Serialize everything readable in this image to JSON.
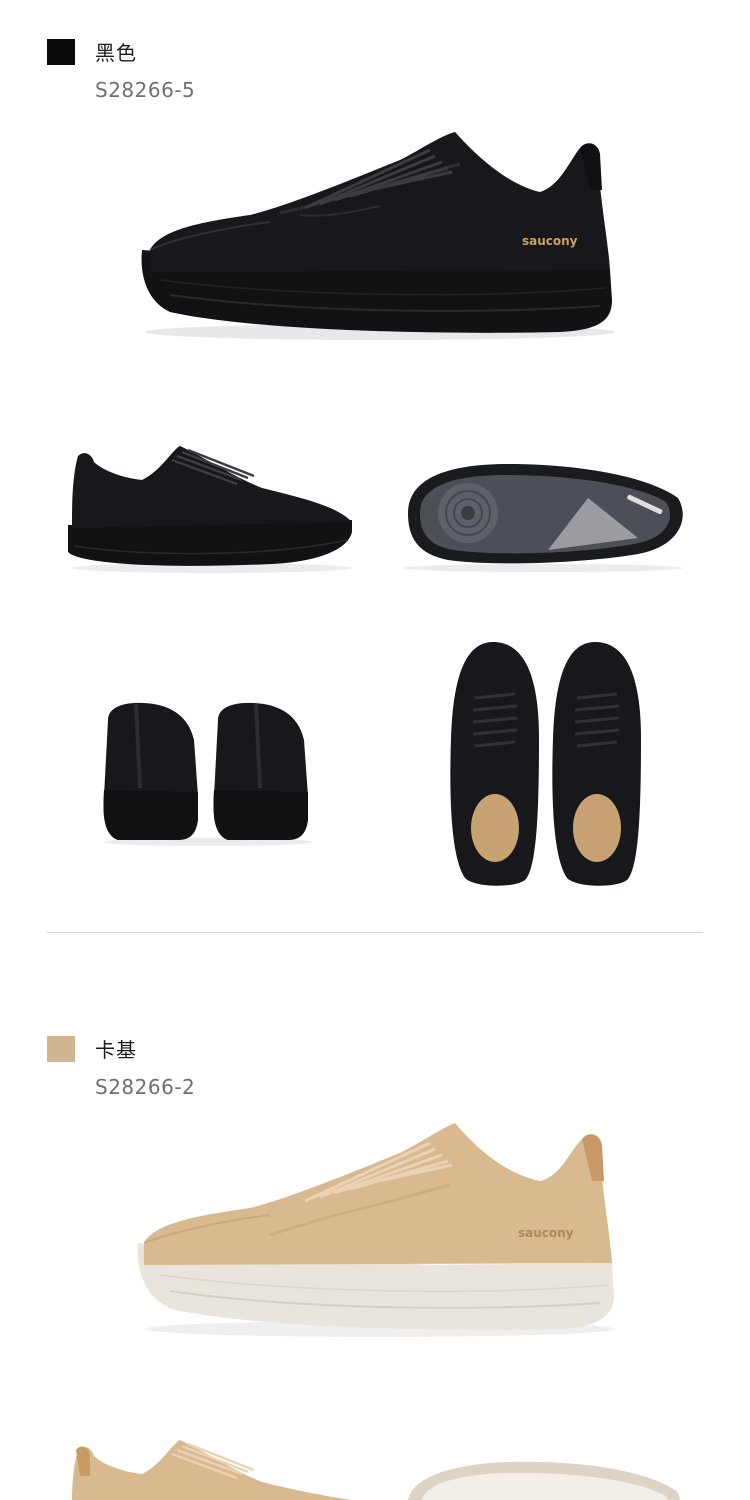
{
  "variants": [
    {
      "color_name": "黑色",
      "sku": "S28266-5",
      "swatch_color": "#0a0a0a",
      "images": [
        "side-view-right",
        "side-view-left",
        "outsole-view",
        "back-view",
        "top-view"
      ],
      "brand_mark": "saucony"
    },
    {
      "color_name": "卡基",
      "sku": "S28266-2",
      "swatch_color": "#d2b68f",
      "images": [
        "side-view-right",
        "side-view-left",
        "outsole-view"
      ],
      "brand_mark": "saucony"
    }
  ],
  "colors": {
    "black_upper": "#17181b",
    "black_sole": "#111214",
    "khaki_upper": "#d8b990",
    "cream_sole": "#e9e4dc",
    "logo_gold": "#c8a266"
  }
}
